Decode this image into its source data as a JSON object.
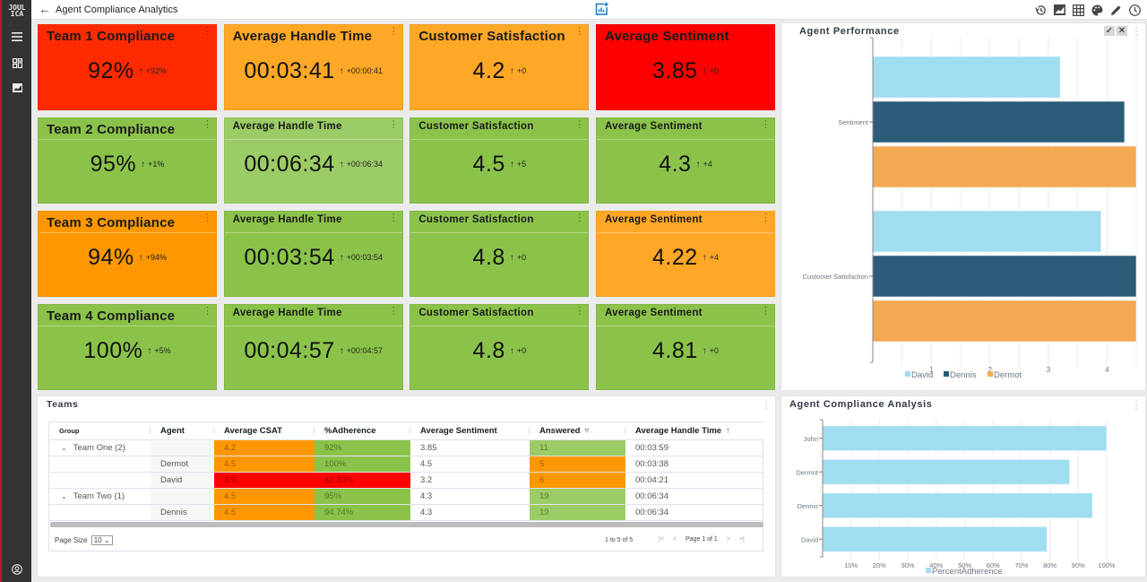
{
  "app": {
    "logo": [
      "JOUL",
      "ICA"
    ],
    "title": "Agent Compliance Analytics",
    "back_icon": "arrow-left-icon",
    "center_icon": "add-chart-icon",
    "header_icons": [
      "history-icon",
      "area-chart-icon",
      "table-grid-icon",
      "palette-icon",
      "pencil-icon",
      "clock-icon"
    ],
    "sidebar_icons": [
      "menu-icon",
      "dashboard-icon",
      "image-chart-icon",
      "user-circle-icon"
    ]
  },
  "tiles": [
    {
      "title": "Team 1 Compliance",
      "value": "92%",
      "delta": "+92%",
      "color": "#ff2a00",
      "variant": "large",
      "separator": false
    },
    {
      "title": "Average Handle Time",
      "value": "00:03:41",
      "delta": "+00:00:41",
      "color": "#ffa726",
      "variant": "large",
      "separator": false
    },
    {
      "title": "Customer Satisfaction",
      "value": "4.2",
      "delta": "+0",
      "color": "#ffa726",
      "variant": "large",
      "separator": false
    },
    {
      "title": "Average Sentiment",
      "value": "3.85",
      "delta": "+0",
      "color": "#ff0000",
      "variant": "large",
      "separator": false
    },
    {
      "title": "Team 2 Compliance",
      "value": "95%",
      "delta": "+1%",
      "color": "#8bc34a",
      "variant": "large",
      "separator": true
    },
    {
      "title": "Average Handle Time",
      "value": "00:06:34",
      "delta": "+00:06:34",
      "color": "#9ccc65",
      "variant": "small",
      "separator": true
    },
    {
      "title": "Customer Satisfaction",
      "value": "4.5",
      "delta": "+5",
      "color": "#8bc34a",
      "variant": "small",
      "separator": true
    },
    {
      "title": "Average Sentiment",
      "value": "4.3",
      "delta": "+4",
      "color": "#8bc34a",
      "variant": "small",
      "separator": true
    },
    {
      "title": "Team 3 Compliance",
      "value": "94%",
      "delta": "+94%",
      "color": "#ff9800",
      "variant": "large",
      "separator": true
    },
    {
      "title": "Average Handle Time",
      "value": "00:03:54",
      "delta": "+00:03:54",
      "color": "#8bc34a",
      "variant": "small",
      "separator": true
    },
    {
      "title": "Customer Satisfaction",
      "value": "4.8",
      "delta": "+0",
      "color": "#8bc34a",
      "variant": "small",
      "separator": true
    },
    {
      "title": "Average Sentiment",
      "value": "4.22",
      "delta": "+4",
      "color": "#ffa726",
      "variant": "small",
      "separator": true
    },
    {
      "title": "Team 4 Compliance",
      "value": "100%",
      "delta": "+5%",
      "color": "#8bc34a",
      "variant": "large",
      "separator": true
    },
    {
      "title": "Average Handle Time",
      "value": "00:04:57",
      "delta": "+00:04:57",
      "color": "#8bc34a",
      "variant": "small",
      "separator": true
    },
    {
      "title": "Customer Satisfaction",
      "value": "4.8",
      "delta": "+0",
      "color": "#8bc34a",
      "variant": "small",
      "separator": true
    },
    {
      "title": "Average Sentiment",
      "value": "4.81",
      "delta": "+0",
      "color": "#8bc34a",
      "variant": "small",
      "separator": true
    }
  ],
  "tile_arrow": "↑",
  "teams": {
    "title": "Teams",
    "columns": [
      "Group",
      "Agent",
      "Average CSAT",
      "%Adherence",
      "Average Sentiment",
      "Answered",
      "Average Handle Time"
    ],
    "column_icons": {
      "Answered": "filter-icon",
      "Average Handle Time": "sort-ascending-icon"
    },
    "rows": [
      {
        "group": "Team One (2)",
        "expandable": true,
        "agent": "",
        "csat": "4.2",
        "csat_color": "#ff9800",
        "adherence": "92%",
        "adherence_color": "#8bc34a",
        "sentiment": "3.85",
        "answered": "11",
        "answered_color": "#9ccc65",
        "aht": "00:03:59"
      },
      {
        "group": "",
        "expandable": false,
        "agent": "Dermot",
        "csat": "4.5",
        "csat_color": "#ff9800",
        "adherence": "100%",
        "adherence_color": "#8bc34a",
        "sentiment": "4.5",
        "answered": "5",
        "answered_color": "#ff9800",
        "aht": "00:03:38"
      },
      {
        "group": "",
        "expandable": false,
        "agent": "David",
        "csat": "3.9",
        "csat_color": "#ff0000",
        "adherence": "83.33%",
        "adherence_color": "#ff0000",
        "sentiment": "3.2",
        "answered": "6",
        "answered_color": "#ff9800",
        "aht": "00:04:21"
      },
      {
        "group": "Team Two (1)",
        "expandable": true,
        "agent": "",
        "csat": "4.5",
        "csat_color": "#ff9800",
        "adherence": "95%",
        "adherence_color": "#8bc34a",
        "sentiment": "4.3",
        "answered": "19",
        "answered_color": "#9ccc65",
        "aht": "00:06:34"
      },
      {
        "group": "",
        "expandable": false,
        "agent": "Dennis",
        "csat": "4.5",
        "csat_color": "#ff9800",
        "adherence": "94.74%",
        "adherence_color": "#8bc34a",
        "sentiment": "4.3",
        "answered": "19",
        "answered_color": "#9ccc65",
        "aht": "00:06:34"
      }
    ],
    "pager": {
      "page_size_label": "Page Size",
      "page_size": "10",
      "summary": "1 to 5 of 5",
      "first": "|<",
      "prev": "<",
      "page_label": "Page 1 of 1",
      "next": ">",
      "last": ">|"
    }
  },
  "chart_data": [
    {
      "type": "bar",
      "orientation": "horizontal",
      "title": "Agent Performance",
      "categories": [
        "Sentiment",
        "Customer Satisfaction"
      ],
      "series": [
        {
          "name": "David",
          "color": "#a0ddf0",
          "values": [
            3.2,
            3.9
          ]
        },
        {
          "name": "Dennis",
          "color": "#2b5d79",
          "values": [
            4.3,
            4.5
          ]
        },
        {
          "name": "Dermot",
          "color": "#f4a955",
          "values": [
            4.5,
            4.5
          ]
        }
      ],
      "xlim": [
        0,
        4.5
      ],
      "xticks": [
        1,
        2,
        3,
        4
      ],
      "grid": true,
      "legend": "bottom",
      "toolbar": [
        "check-icon",
        "close-icon"
      ]
    },
    {
      "type": "bar",
      "orientation": "horizontal",
      "title": "Agent Compliance Analysis",
      "categories": [
        "John",
        "Dermot",
        "Dennis",
        "David"
      ],
      "series": [
        {
          "name": "PercentAdherence",
          "color": "#a0ddf0",
          "values": [
            100,
            87,
            95,
            79
          ]
        }
      ],
      "xlim": [
        0,
        100
      ],
      "xticks": [
        "10%",
        "20%",
        "30%",
        "40%",
        "50%",
        "60%",
        "70%",
        "80%",
        "90%",
        "100%"
      ],
      "grid": true,
      "legend": "bottom"
    }
  ]
}
